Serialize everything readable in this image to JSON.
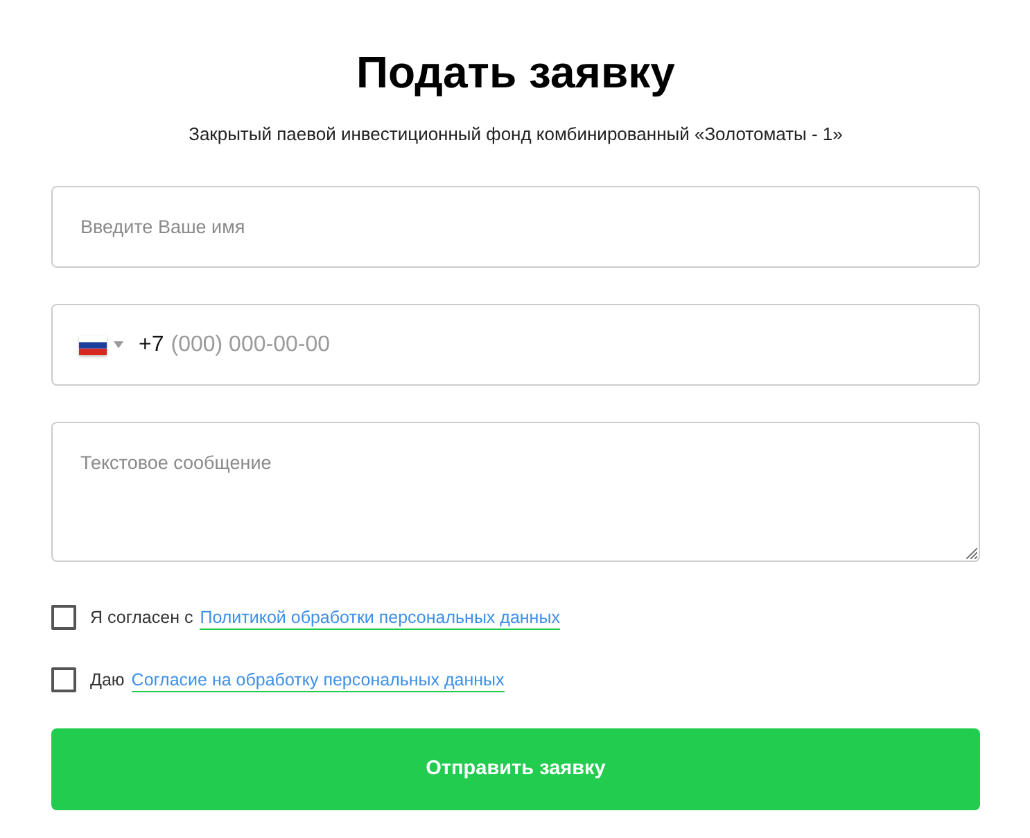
{
  "title": "Подать заявку",
  "subtitle": "Закрытый паевой инвестиционный фонд комбинированный «Золотоматы - 1»",
  "fields": [
    {
      "kind": "text",
      "placeholder": "Введите Ваше имя"
    },
    {
      "kind": "phone",
      "prefix": "+7",
      "placeholder": "(000) 000-00-00"
    },
    {
      "kind": "textarea",
      "placeholder": "Текстовое сообщение"
    }
  ],
  "consents": [
    {
      "text": "Я согласен с",
      "link": "Политикой обработки персональных данных",
      "checked": false
    },
    {
      "text": "Даю",
      "link": "Согласие на обработку персональных данных",
      "checked": false
    }
  ],
  "submit": {
    "label": "Отправить заявку"
  }
}
